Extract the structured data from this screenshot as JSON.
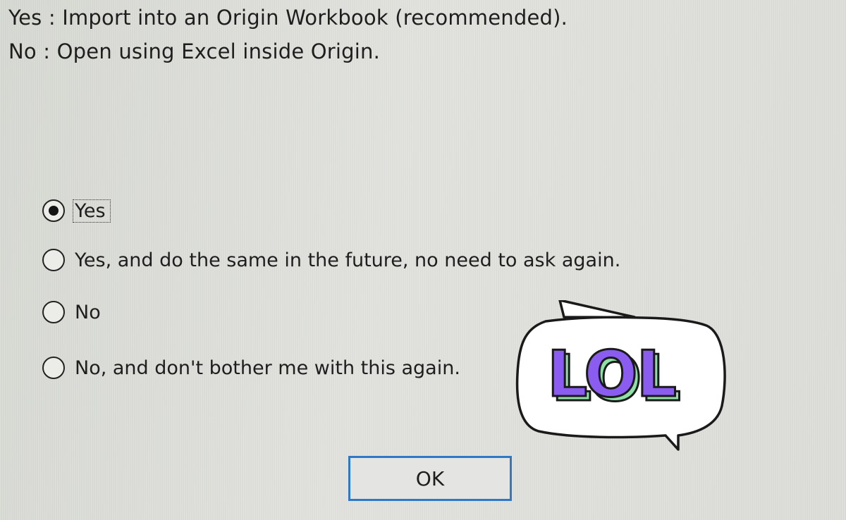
{
  "dialog": {
    "message_line_1": "Yes : Import into an Origin Workbook (recommended).",
    "message_line_2": "No : Open using Excel inside Origin."
  },
  "options": [
    {
      "label": "Yes",
      "selected": true
    },
    {
      "label": "Yes, and do the same in the future, no need to ask again.",
      "selected": false
    },
    {
      "label": "No",
      "selected": false
    },
    {
      "label": "No, and don't bother me with this again.",
      "selected": false
    }
  ],
  "ok_button": {
    "label": "OK"
  },
  "sticker": {
    "text": "LOL",
    "fill_color": "#8b5cf0",
    "shadow_color": "#8fe0a8",
    "outline_color": "#1a1a1a"
  },
  "colors": {
    "button_focus_border": "#2f78c8"
  }
}
